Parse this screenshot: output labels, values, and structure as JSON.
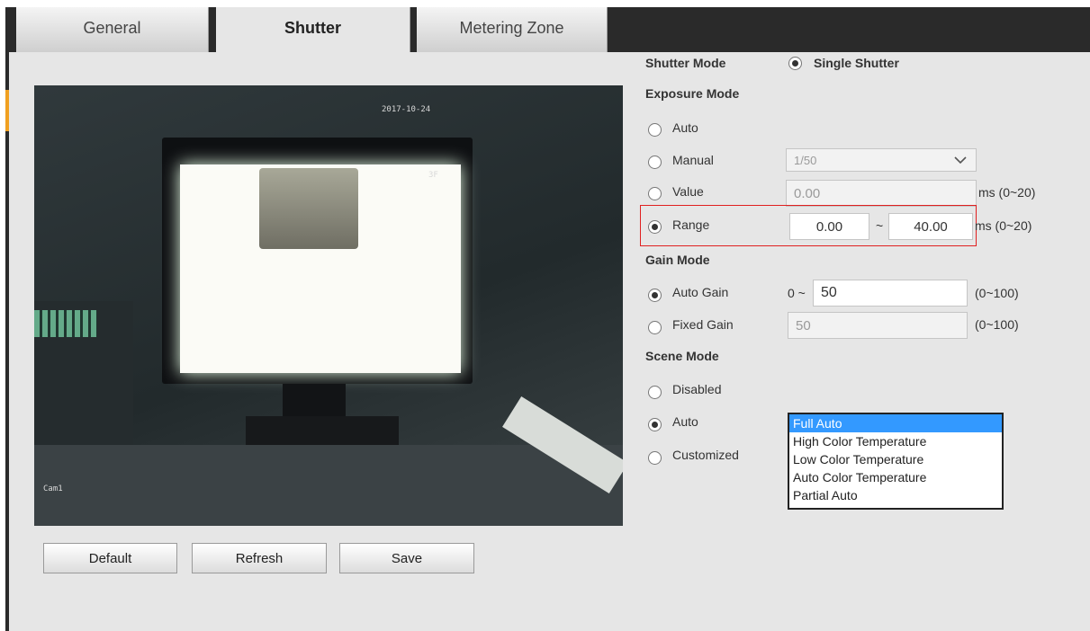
{
  "tabs": [
    {
      "label": "General",
      "active": false
    },
    {
      "label": "Shutter",
      "active": true
    },
    {
      "label": "Metering Zone",
      "active": false
    }
  ],
  "video": {
    "osd_time": "2017-10-24",
    "osd_small": "3F",
    "osd_channel": "Cam1"
  },
  "shutter_mode": {
    "label": "Shutter Mode",
    "option": "Single Shutter",
    "selected": true
  },
  "exposure_mode": {
    "label": "Exposure Mode",
    "options": [
      {
        "label": "Auto",
        "selected": false
      },
      {
        "label": "Manual",
        "selected": false
      },
      {
        "label": "Value",
        "selected": false
      },
      {
        "label": "Range",
        "selected": true
      }
    ],
    "manual_value": "1/50",
    "value_field": "0.00",
    "value_unit": "ms (0~20)",
    "range_min": "0.00",
    "range_sep": "~",
    "range_max": "40.00",
    "range_unit": "ms (0~20)"
  },
  "gain_mode": {
    "label": "Gain Mode",
    "auto_label": "Auto Gain",
    "auto_selected": true,
    "auto_prefix": "0 ~",
    "auto_value": "50",
    "auto_range": "(0~100)",
    "fixed_label": "Fixed Gain",
    "fixed_selected": false,
    "fixed_value": "50",
    "fixed_range": "(0~100)"
  },
  "scene_mode": {
    "label": "Scene Mode",
    "options": [
      {
        "label": "Disabled",
        "selected": false
      },
      {
        "label": "Auto",
        "selected": true
      },
      {
        "label": "Customized",
        "selected": false
      }
    ],
    "list": [
      "Full Auto",
      "High Color Temperature",
      "Low Color Temperature",
      "Auto Color Temperature",
      "Partial Auto"
    ],
    "list_selected": "Full Auto"
  },
  "buttons": {
    "default": "Default",
    "refresh": "Refresh",
    "save": "Save"
  },
  "colors": {
    "accent_tab_marker": "#f0a020",
    "highlight_border": "#e02020",
    "list_selection": "#3399ff"
  }
}
